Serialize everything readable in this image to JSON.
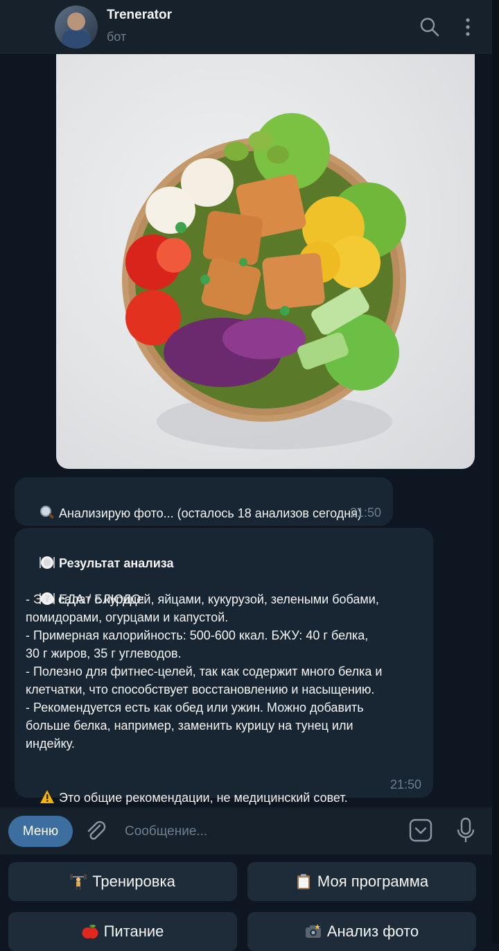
{
  "header": {
    "bot_name": "Trenerator",
    "bot_status": "бот",
    "icons": [
      "search-icon",
      "more-vertical-icon"
    ]
  },
  "photo": {
    "subject": "salad bowl"
  },
  "messages": [
    {
      "icon": "magnifier-emoji",
      "text": "Анализирую фото... (осталось 18 анализов сегодня)",
      "time": "21:50"
    },
    {
      "title_icon": "plate-emoji",
      "title": "Результат анализа",
      "section_icon": "plate-emoji",
      "section": "ЕДА / БЛЮДО:",
      "lines": [
        "- Это салат с курицей, яйцами, кукурузой, зелеными бобами,",
        "помидорами, огурцами и капустой.",
        "- Примерная калорийность: 500-600 ккал. БЖУ: 40 г белка,",
        "30 г жиров, 35 г углеводов.",
        "- Полезно для фитнес-целей, так как содержит много белка и",
        "клетчатки, что способствует восстановлению и насыщению.",
        "- Рекомендуется есть как обед или ужин. Можно добавить",
        "больше белка, например, заменить курицу на тунец или",
        "индейку."
      ],
      "warning_icon": "warning-emoji",
      "warning": "Это общие рекомендации, не медицинский совет.",
      "time": "21:50"
    }
  ],
  "input": {
    "menu_label": "Меню",
    "placeholder": "Сообщение..."
  },
  "keyboard": [
    {
      "icon": "weightlifter-emoji",
      "label": "Тренировка"
    },
    {
      "icon": "clipboard-emoji",
      "label": "Моя программа"
    },
    {
      "icon": "apple-emoji",
      "label": "Питание"
    },
    {
      "icon": "camera-emoji",
      "label": "Анализ фото"
    }
  ],
  "colors": {
    "background": "#0e1621",
    "header": "#17212b",
    "bubble": "#182533",
    "accent": "#3d6ea0",
    "muted": "#6d7f8f"
  }
}
